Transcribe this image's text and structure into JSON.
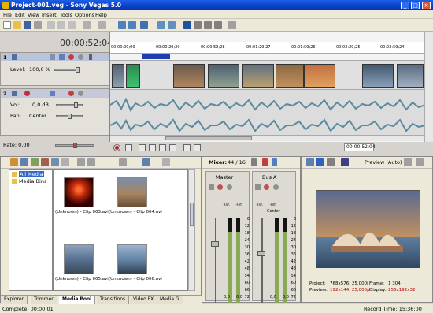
{
  "window": {
    "title": "Project-001.veg - Sony Vegas 5.0"
  },
  "menu": [
    "File",
    "Edit",
    "View",
    "Insert",
    "Tools",
    "Options",
    "Help"
  ],
  "timeline": {
    "timecode": "00:00:52:04",
    "ruler_ticks": [
      "00:00:00;00",
      "00:00:29;29",
      "00:00:59;28",
      "00:01:29;27",
      "00:01:59;26",
      "00:02:29;25",
      "00:02:59;24"
    ],
    "video_track": {
      "number": "1",
      "level_label": "Level:",
      "level_value": "100,0 %"
    },
    "audio_track": {
      "number": "2",
      "vol_label": "Vol:",
      "vol_value": "0,0 dB",
      "pan_label": "Pan:",
      "pan_value": "Center"
    },
    "rate_label": "Rate: 0,00",
    "transport_timecode": "00:00:52:04"
  },
  "explorer": {
    "tree": [
      "All Media",
      "Media Bins"
    ],
    "clips": [
      {
        "label": "(Unknown) - Clip 003.avi"
      },
      {
        "label": "(Unknown) - Clip 004.avi"
      },
      {
        "label": "(Unknown) - Clip 005.avi"
      },
      {
        "label": "(Unknown) - Clip 006.avi"
      }
    ],
    "tabs": [
      "Explorer",
      "Trimmer",
      "Media Pool",
      "Transitions",
      "Video FX",
      "Media G"
    ],
    "active_tab": "Media Pool"
  },
  "mixer": {
    "title": "Mixer:",
    "count": "44 / 16",
    "channels": [
      {
        "name": "Master",
        "left_db": "-Inf.",
        "right_db": "-Inf.",
        "left_val": "0,0",
        "right_val": "0,0",
        "level": 0.83
      },
      {
        "name": "Bus A",
        "left_db": "-Inf.",
        "right_db": "-Inf.",
        "left_val": "0,0",
        "right_val": "0,0",
        "pan": "Center",
        "level": 0.83
      }
    ],
    "scale": [
      "6",
      "12",
      "18",
      "24",
      "30",
      "36",
      "42",
      "48",
      "54",
      "60",
      "66",
      "72"
    ]
  },
  "preview": {
    "mode": "Preview (Auto)",
    "project_label": "Project:",
    "project_value": "768x576; 25,000i",
    "preview_label": "Preview:",
    "preview_value": "192x144; 25,000p",
    "frame_label": "Frame:",
    "frame_value": "1 304",
    "display_label": "Display:",
    "display_value": "256x192x32"
  },
  "status": {
    "left": "Complete: 00:00:01",
    "right": "Record Time: 15:36:00"
  }
}
